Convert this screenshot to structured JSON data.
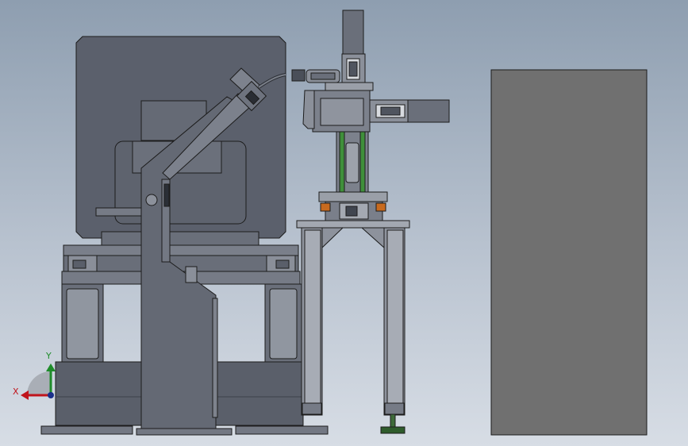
{
  "triad": {
    "x_label": "X",
    "y_label": "Y",
    "x_color": "#c0141c",
    "y_color": "#1e8c2a",
    "origin_color": "#1a2f8a"
  },
  "colors": {
    "steel_dark": "#4f5460",
    "steel": "#6a6f7a",
    "steel_light": "#8f949e",
    "outline": "#1c1c1c",
    "panel": "#707070",
    "rail_green": "#3f8f3a",
    "accent_orange": "#c86a1e"
  }
}
